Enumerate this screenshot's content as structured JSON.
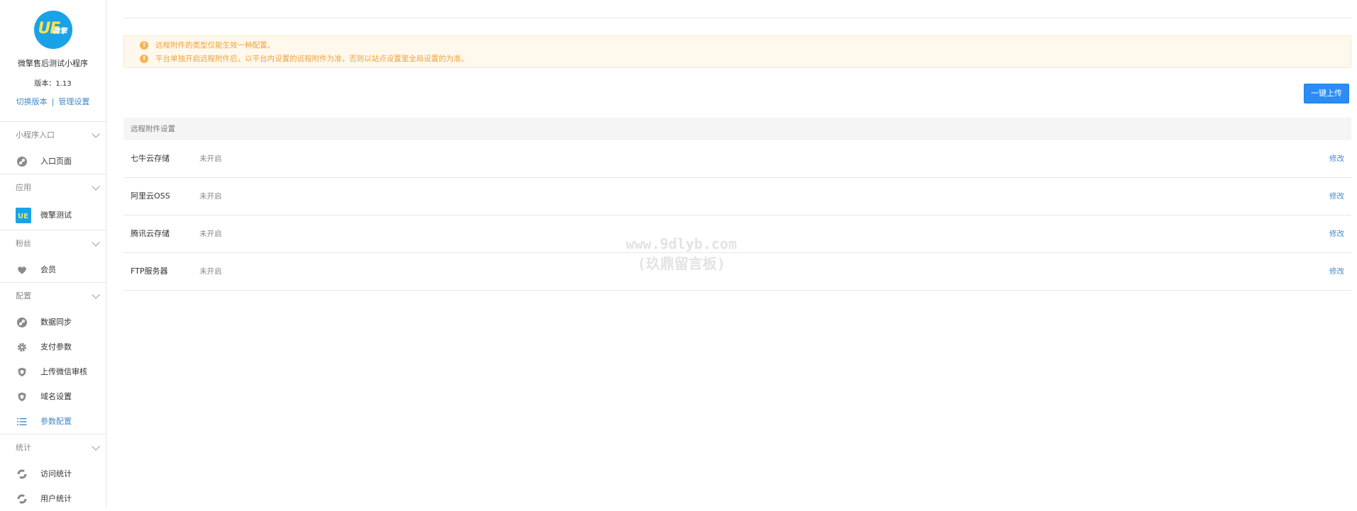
{
  "account": {
    "logo_text": "UE",
    "logo_cn": "微擎",
    "name": "微擎售后测试小程序",
    "version": "版本：1.13",
    "switch_version": "切换版本",
    "separator": "|",
    "manage_settings": "管理设置"
  },
  "sidebar": {
    "groups": [
      {
        "title": "小程序入口",
        "items": [
          {
            "label": "入口页面",
            "icon": "link-icon"
          }
        ]
      },
      {
        "title": "应用",
        "items": [
          {
            "label": "微擎测试",
            "icon": "app-logo-icon"
          }
        ]
      },
      {
        "title": "粉丝",
        "items": [
          {
            "label": "会员",
            "icon": "heart-icon"
          }
        ]
      },
      {
        "title": "配置",
        "items": [
          {
            "label": "数据同步",
            "icon": "link-icon"
          },
          {
            "label": "支付参数",
            "icon": "gear-icon"
          },
          {
            "label": "上传微信审核",
            "icon": "shield-icon"
          },
          {
            "label": "域名设置",
            "icon": "shield-icon"
          },
          {
            "label": "参数配置",
            "icon": "list-icon",
            "active": true
          }
        ]
      },
      {
        "title": "统计",
        "items": [
          {
            "label": "访问统计",
            "icon": "refresh-icon"
          },
          {
            "label": "用户统计",
            "icon": "refresh-icon"
          }
        ]
      }
    ]
  },
  "alert": {
    "lines": [
      "远程附件的类型仅能生效一种配置。",
      "平台单独开启远程附件后，以平台内设置的远程附件为准，否则以站点设置里全局设置的为准。"
    ],
    "icon": "!"
  },
  "toolbar": {
    "upload_label": "一键上传"
  },
  "table": {
    "header": "远程附件设置",
    "rows": [
      {
        "name": "七牛云存储",
        "status": "未开启",
        "action": "修改"
      },
      {
        "name": "阿里云OSS",
        "status": "未开启",
        "action": "修改"
      },
      {
        "name": "腾讯云存储",
        "status": "未开启",
        "action": "修改"
      },
      {
        "name": "FTP服务器",
        "status": "未开启",
        "action": "修改"
      }
    ]
  },
  "watermark": {
    "line1": "www.9dlyb.com",
    "line2": "(玖鼎留言板)"
  },
  "colors": {
    "accent": "#2b8cf4",
    "link": "#428bca",
    "warning": "#f0a33c"
  }
}
